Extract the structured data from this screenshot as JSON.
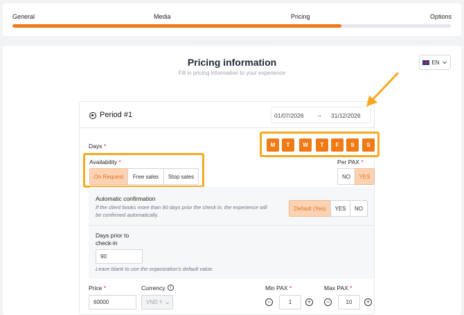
{
  "stepper": {
    "steps": [
      "General",
      "Media",
      "Pricing",
      "Options"
    ],
    "progress_percent": 75
  },
  "header": {
    "title": "Pricing information",
    "subtitle": "Fill in pricing information to your experience",
    "language": "EN"
  },
  "period": {
    "label": "Period #1",
    "date_from": "01/07/2026",
    "date_to": "31/12/2026",
    "arrow": "→"
  },
  "days": {
    "label": "Days",
    "items": [
      "M",
      "T",
      "W",
      "T",
      "F",
      "S",
      "S"
    ]
  },
  "availability": {
    "label": "Availability",
    "options": [
      "On Request",
      "Free sales",
      "Stop sales"
    ],
    "selected": "On Request"
  },
  "per_pax": {
    "label": "Per PAX",
    "options": [
      "NO",
      "YES"
    ],
    "selected": "YES"
  },
  "auto_confirm": {
    "label": "Automatic confirmation",
    "note": "If the client books more than 90 days prior the check in, the experience will be confirmed automatically.",
    "options": [
      "Default (Yes)",
      "YES",
      "NO"
    ],
    "selected": "Default (Yes)"
  },
  "days_prior": {
    "label_line1": "Days prior to",
    "label_line2": "check-in",
    "value": "90",
    "note": "Leave blank to use the organization's default value."
  },
  "price": {
    "label": "Price",
    "value": "60000"
  },
  "currency": {
    "label": "Currency",
    "value": "VND ₫"
  },
  "min_pax": {
    "label": "Min PAX",
    "value": "1"
  },
  "max_pax": {
    "label": "Max PAX",
    "value": "10"
  },
  "required_mark": "*",
  "colors": {
    "accent": "#f07a14",
    "highlight": "#f6a821",
    "selected_bg": "#fbd3b4"
  }
}
